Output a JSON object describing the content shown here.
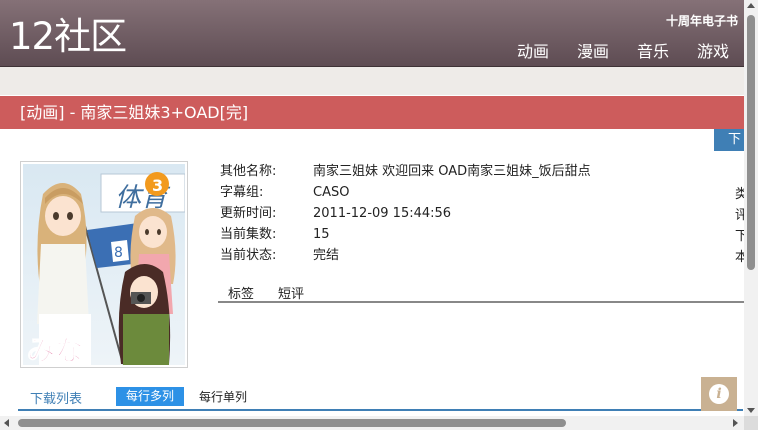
{
  "header": {
    "logo": "12社区",
    "anniversary_link": "十周年电子书",
    "nav": [
      "动画",
      "漫画",
      "音乐",
      "游戏"
    ]
  },
  "title_bar": {
    "title": "[动画] - 南家三姐妹3+OAD[完]"
  },
  "download_button": {
    "label": "下"
  },
  "info": {
    "rows": [
      {
        "label": "其他名称:",
        "value": "南家三姐妹 欢迎回来 OAD南家三姐妹_饭后甜点"
      },
      {
        "label": "字幕组:",
        "value": "CASO"
      },
      {
        "label": "更新时间:",
        "value": "2011-12-09 15:44:56"
      },
      {
        "label": "当前集数:",
        "value": "15"
      },
      {
        "label": "当前状态:",
        "value": "完结"
      }
    ],
    "side_column": [
      "类",
      "评",
      "下",
      "本"
    ]
  },
  "tabs": [
    "标签",
    "短评"
  ],
  "download_list": {
    "title": "下载列表",
    "multi_label": "每行多列",
    "single_label": "每行单列"
  },
  "cover": {
    "badge_number": "3",
    "badge_text": "みな"
  },
  "colors": {
    "header_bg": "#6d5a60",
    "title_bar_bg": "#cd5c5c",
    "accent_blue": "#3f7fb5",
    "info_button_bg": "#c9b192"
  },
  "icons": {
    "info_button": "info-icon"
  }
}
